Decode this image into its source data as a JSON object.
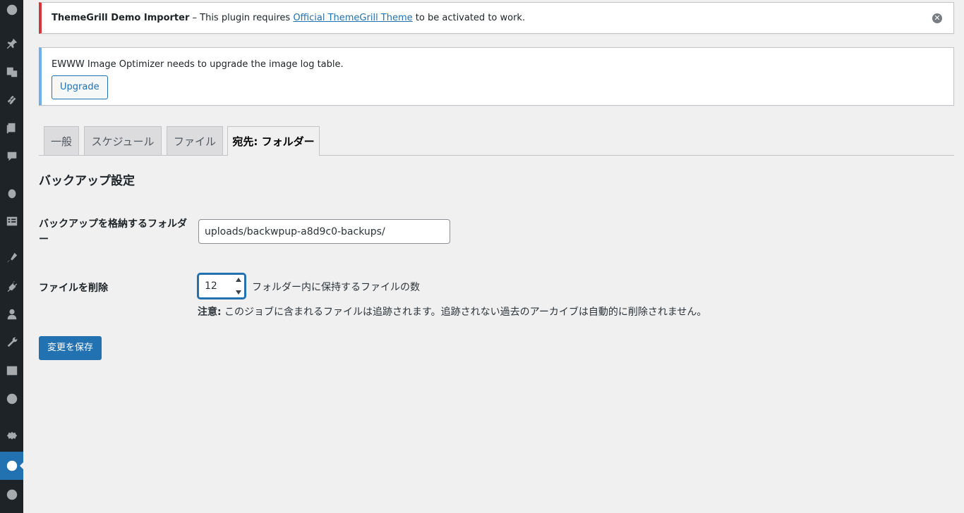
{
  "sidebar": {
    "icons": [
      "dashboard-icon",
      "pin-icon",
      "media-icon",
      "link-icon",
      "pages-icon",
      "comments-icon",
      "circle-icon",
      "form-icon",
      "appearance-icon",
      "plugins-icon",
      "users-icon",
      "tools-icon",
      "settings-grid-icon",
      "gear-circle-icon",
      "settings-icon",
      "backwpup-icon",
      "play-icon"
    ],
    "active": "backwpup-icon"
  },
  "notices": {
    "demo": {
      "plugin": "ThemeGrill Demo Importer",
      "text_before": " – This plugin requires ",
      "link": "Official ThemeGrill Theme",
      "text_after": " to be activated to work."
    },
    "ewww": {
      "text": "EWWW Image Optimizer needs to upgrade the image log table.",
      "button": "Upgrade"
    }
  },
  "tabs": [
    {
      "label": "一般",
      "active": false
    },
    {
      "label": "スケジュール",
      "active": false
    },
    {
      "label": "ファイル",
      "active": false
    },
    {
      "label": "宛先: フォルダー",
      "active": true
    }
  ],
  "section_title": "バックアップ設定",
  "fields": {
    "folder": {
      "label": "バックアップを格納するフォルダー",
      "value": "uploads/backwpup-a8d9c0-backups/"
    },
    "delete": {
      "label": "ファイルを削除",
      "value": "12",
      "suffix": "フォルダー内に保持するファイルの数",
      "note_label": "注意:",
      "note_text": " このジョブに含まれるファイルは追跡されます。追跡されない過去のアーカイブは自動的に削除されません。"
    }
  },
  "save_button": "変更を保存",
  "colors": {
    "accent": "#2271b1",
    "error": "#d63638",
    "info": "#72aee6",
    "sidebar": "#1d2327",
    "background": "#f0f0f1"
  }
}
